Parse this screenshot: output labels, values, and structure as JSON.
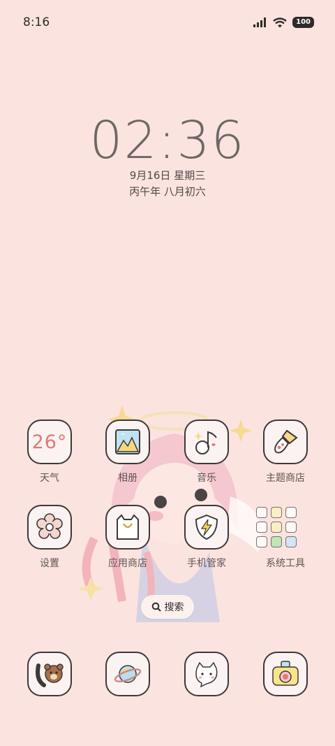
{
  "status_bar": {
    "time": "8:16",
    "battery": "100"
  },
  "lock": {
    "time": "02:36",
    "date": "9月16日 星期三",
    "lunar": "丙午年 八月初六"
  },
  "apps": {
    "weather": {
      "label": "天气",
      "temp": "26°"
    },
    "gallery": {
      "label": "相册"
    },
    "music": {
      "label": "音乐"
    },
    "themes": {
      "label": "主题商店"
    },
    "settings": {
      "label": "设置"
    },
    "app_store": {
      "label": "应用商店"
    },
    "security": {
      "label": "手机管家"
    },
    "tools": {
      "label": "系统工具"
    }
  },
  "search": {
    "label": "搜索"
  },
  "dock": {
    "phone": "phone-bear-icon",
    "browser": "planet-icon",
    "messages": "cat-message-icon",
    "camera": "camera-icon"
  },
  "colors": {
    "background": "#fbe3df",
    "accent": "#e07a76",
    "icon_outline": "#3e3836"
  }
}
